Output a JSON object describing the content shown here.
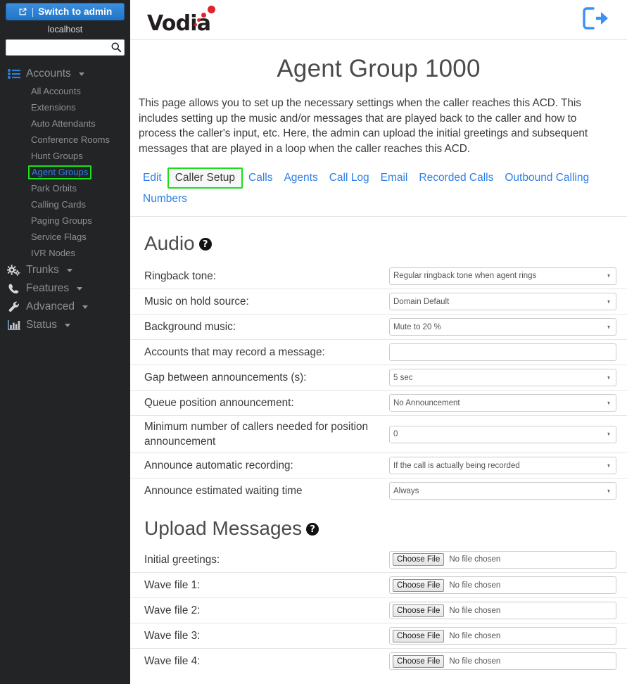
{
  "sidebar": {
    "switch_button": {
      "label": "Switch to admin",
      "separator": "|",
      "icon": "external-link-icon"
    },
    "host": "localhost",
    "search": {
      "value": "",
      "placeholder": ""
    },
    "groups": [
      {
        "label": "Accounts",
        "icon": "list-icon",
        "expanded": true,
        "items": [
          {
            "label": "All Accounts",
            "active": false
          },
          {
            "label": "Extensions",
            "active": false
          },
          {
            "label": "Auto Attendants",
            "active": false
          },
          {
            "label": "Conference Rooms",
            "active": false
          },
          {
            "label": "Hunt Groups",
            "active": false
          },
          {
            "label": "Agent Groups",
            "active": true
          },
          {
            "label": "Park Orbits",
            "active": false
          },
          {
            "label": "Calling Cards",
            "active": false
          },
          {
            "label": "Paging Groups",
            "active": false
          },
          {
            "label": "Service Flags",
            "active": false
          },
          {
            "label": "IVR Nodes",
            "active": false
          }
        ]
      },
      {
        "label": "Trunks",
        "icon": "gears-icon",
        "expanded": false,
        "items": []
      },
      {
        "label": "Features",
        "icon": "phone-icon",
        "expanded": false,
        "items": []
      },
      {
        "label": "Advanced",
        "icon": "wrench-icon",
        "expanded": false,
        "items": []
      },
      {
        "label": "Status",
        "icon": "bar-chart-icon",
        "expanded": false,
        "items": []
      }
    ]
  },
  "header": {
    "logo_text": "Vodia",
    "logout_icon": "logout-icon"
  },
  "page": {
    "title": "Agent Group 1000",
    "description": "This page allows you to set up the necessary settings when the caller reaches this ACD. This includes setting up the music and/or messages that are played back to the caller and how to process the caller's input, etc. Here, the admin can upload the initial greetings and subsequent messages that are played in a loop when the caller reaches this ACD."
  },
  "tabs": [
    {
      "label": "Edit",
      "active": false
    },
    {
      "label": "Caller Setup",
      "active": true
    },
    {
      "label": "Calls",
      "active": false
    },
    {
      "label": "Agents",
      "active": false
    },
    {
      "label": "Call Log",
      "active": false
    },
    {
      "label": "Email",
      "active": false
    },
    {
      "label": "Recorded Calls",
      "active": false
    },
    {
      "label": "Outbound Calling",
      "active": false
    },
    {
      "label": "Numbers",
      "active": false
    }
  ],
  "audio": {
    "section_title": "Audio",
    "help_icon": "help-icon",
    "fields": [
      {
        "label": "Ringback tone:",
        "type": "select",
        "value": "Regular ringback tone when agent rings"
      },
      {
        "label": "Music on hold source:",
        "type": "select",
        "value": "Domain Default"
      },
      {
        "label": "Background music:",
        "type": "select",
        "value": "Mute to 20 %"
      },
      {
        "label": "Accounts that may record a message:",
        "type": "text",
        "value": ""
      },
      {
        "label": "Gap between announcements (s):",
        "type": "select",
        "value": "5 sec"
      },
      {
        "label": "Queue position announcement:",
        "type": "select",
        "value": "No Announcement"
      },
      {
        "label": "Minimum number of callers needed for position announcement",
        "type": "select",
        "value": "0"
      },
      {
        "label": "Announce automatic recording:",
        "type": "select",
        "value": "If the call is actually being recorded"
      },
      {
        "label": "Announce estimated waiting time",
        "type": "select",
        "value": "Always"
      }
    ]
  },
  "upload": {
    "section_title": "Upload Messages",
    "help_icon": "help-icon",
    "choose_label": "Choose File",
    "no_file_label": "No file chosen",
    "fields": [
      {
        "label": "Initial greetings:"
      },
      {
        "label": "Wave file 1:"
      },
      {
        "label": "Wave file 2:"
      },
      {
        "label": "Wave file 3:"
      },
      {
        "label": "Wave file 4:"
      }
    ]
  },
  "colors": {
    "sidebar_bg": "#222426",
    "accent_blue": "#2f7fe8",
    "highlight_green": "#19e019",
    "logo_red": "#e1242a"
  }
}
